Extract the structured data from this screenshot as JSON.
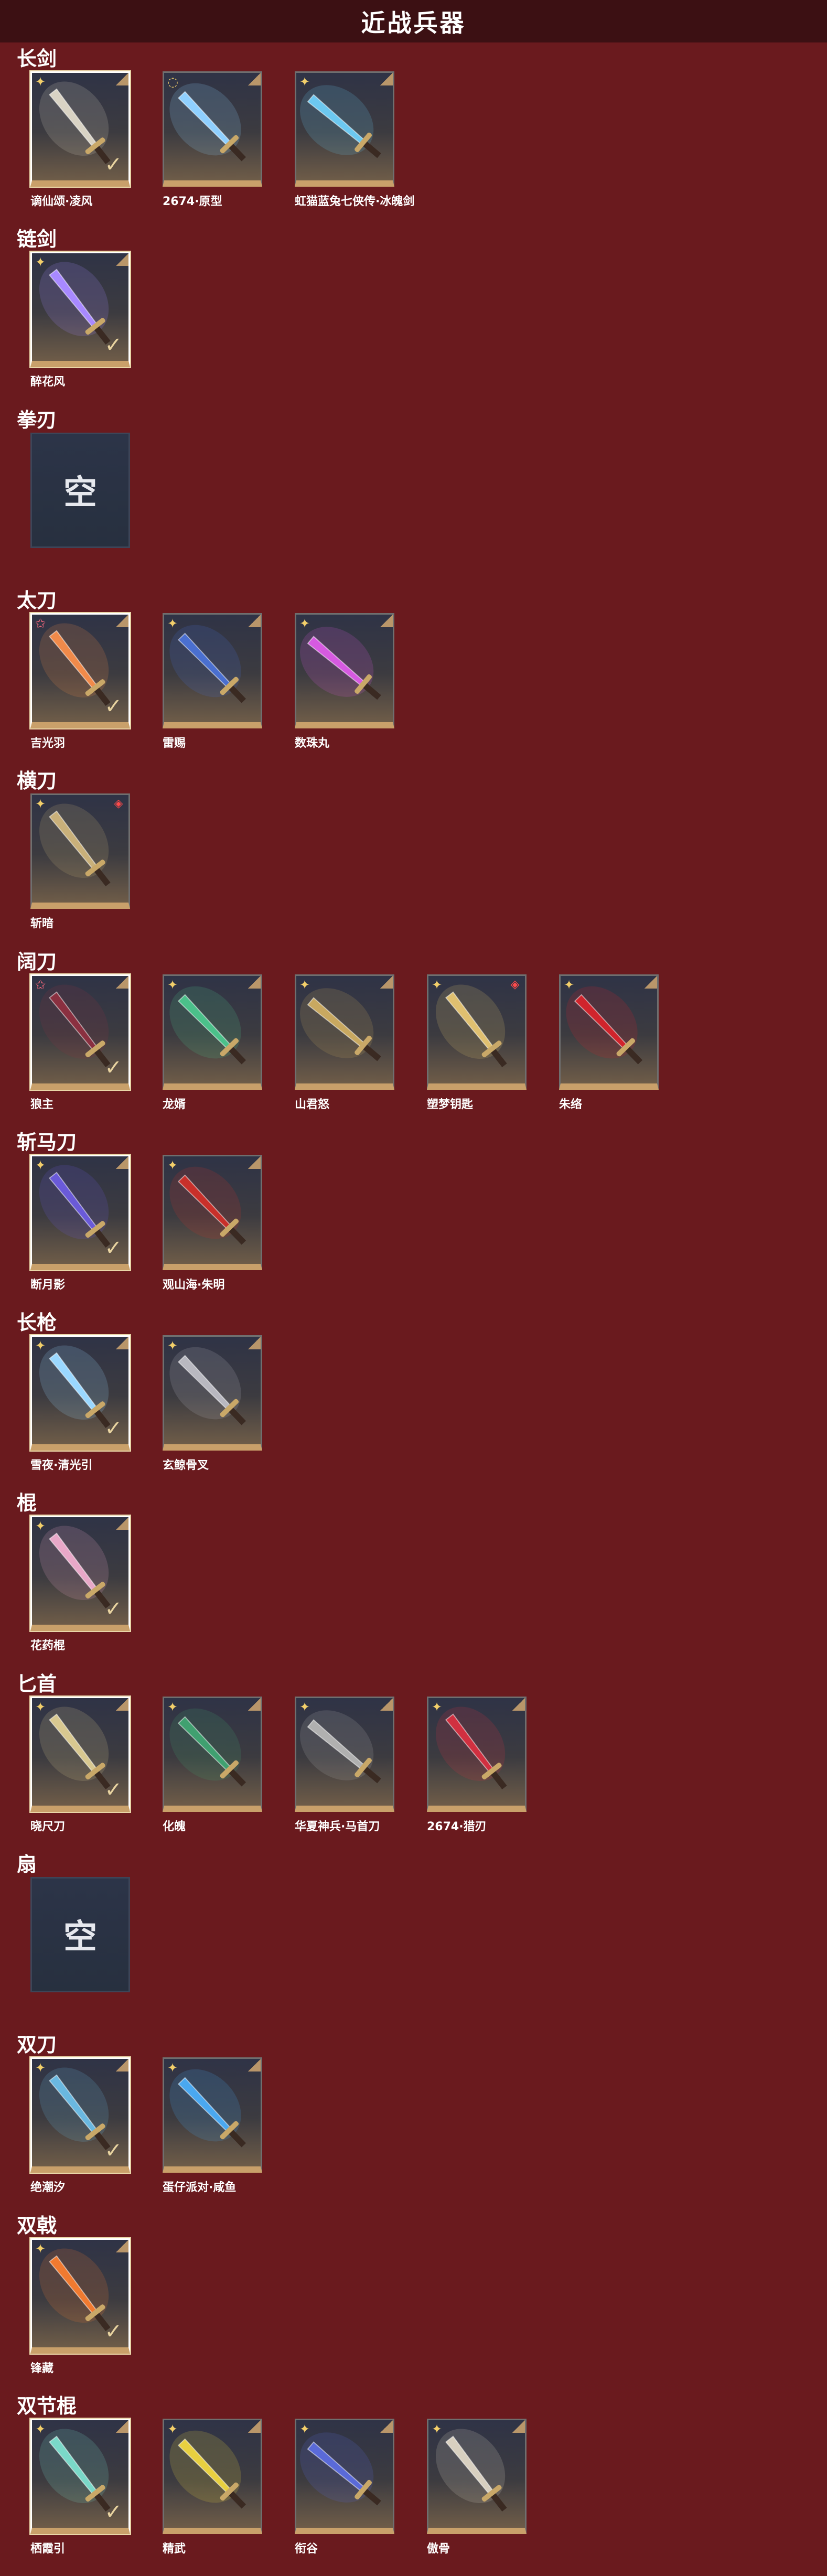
{
  "page": {
    "title": "近战兵器"
  },
  "categories": [
    {
      "title": "长剑",
      "items": [
        {
          "name": "谪仙颂·凌风",
          "rarity": "gold",
          "selected": true,
          "art": "sword-dark-icon",
          "color": "#d9d3c4"
        },
        {
          "name": "2674·原型",
          "rarity": "rainbow",
          "selected": false,
          "art": "sword-light-icon",
          "color": "#8fd0ff"
        },
        {
          "name": "虹猫蓝兔七侠传·冰魄剑",
          "rarity": "gold",
          "selected": false,
          "art": "sword-ice-icon",
          "color": "#6cc8f0"
        }
      ]
    },
    {
      "title": "链剑",
      "items": [
        {
          "name": "醉花风",
          "rarity": "gold",
          "selected": true,
          "art": "chain-sword-icon",
          "color": "#a889ff"
        }
      ]
    },
    {
      "title": "拳刃",
      "items": [
        {
          "name": "",
          "empty": true,
          "empty_text": "空"
        }
      ]
    },
    {
      "title": "太刀",
      "items": [
        {
          "name": "吉光羽",
          "rarity": "pink",
          "selected": true,
          "art": "katana-flame-icon",
          "color": "#f08a4a"
        },
        {
          "name": "雷赐",
          "rarity": "gold",
          "selected": false,
          "art": "katana-blue-icon",
          "color": "#4a6fd0"
        },
        {
          "name": "数珠丸",
          "rarity": "gold",
          "selected": false,
          "art": "katana-purple-icon",
          "color": "#d65ae0"
        }
      ]
    },
    {
      "title": "横刀",
      "items": [
        {
          "name": "斩暗",
          "rarity": "gold",
          "selected": false,
          "art": "saber-gold-icon",
          "color": "#c9b07a",
          "badge": "red-diamond"
        }
      ]
    },
    {
      "title": "阔刀",
      "items": [
        {
          "name": "狼主",
          "rarity": "pink",
          "selected": true,
          "art": "broadblade-dark-icon",
          "color": "#8a3040"
        },
        {
          "name": "龙婿",
          "rarity": "gold",
          "selected": false,
          "art": "broadblade-jade-icon",
          "color": "#4bc08a"
        },
        {
          "name": "山君怒",
          "rarity": "gold",
          "selected": false,
          "art": "broadblade-gold-icon",
          "color": "#c8a860"
        },
        {
          "name": "塑梦钥匙",
          "rarity": "gold",
          "selected": false,
          "art": "broadblade-key-icon",
          "color": "#e0c070",
          "badge": "red-diamond"
        },
        {
          "name": "朱络",
          "rarity": "gold",
          "selected": false,
          "art": "broadblade-red-icon",
          "color": "#d0242c"
        }
      ]
    },
    {
      "title": "斩马刀",
      "items": [
        {
          "name": "断月影",
          "rarity": "gold",
          "selected": true,
          "art": "glaive-purple-icon",
          "color": "#6a5ad8"
        },
        {
          "name": "观山海·朱明",
          "rarity": "gold",
          "selected": false,
          "art": "glaive-red-icon",
          "color": "#c8302a"
        }
      ]
    },
    {
      "title": "长枪",
      "items": [
        {
          "name": "雪夜·清光引",
          "rarity": "gold",
          "selected": true,
          "art": "spear-ice-icon",
          "color": "#9ad8ff"
        },
        {
          "name": "玄鲸骨叉",
          "rarity": "gold",
          "selected": false,
          "art": "trident-silver-icon",
          "color": "#b8b8c0"
        }
      ]
    },
    {
      "title": "棍",
      "items": [
        {
          "name": "花药棍",
          "rarity": "gold",
          "selected": true,
          "art": "staff-flower-icon",
          "color": "#e8a8c8"
        }
      ]
    },
    {
      "title": "匕首",
      "items": [
        {
          "name": "晓尺刀",
          "rarity": "gold",
          "selected": true,
          "art": "dagger-gold-icon",
          "color": "#d8c890"
        },
        {
          "name": "化魄",
          "rarity": "gold",
          "selected": false,
          "art": "dagger-green-icon",
          "color": "#40a070"
        },
        {
          "name": "华夏神兵·马首刀",
          "rarity": "gold",
          "selected": false,
          "art": "dagger-horse-icon",
          "color": "#b0b0b0"
        },
        {
          "name": "2674·猎刃",
          "rarity": "gold",
          "selected": false,
          "art": "dagger-red-icon",
          "color": "#d03040"
        }
      ]
    },
    {
      "title": "扇",
      "items": [
        {
          "name": "",
          "empty": true,
          "empty_text": "空"
        }
      ]
    },
    {
      "title": "双刀",
      "items": [
        {
          "name": "绝潮汐",
          "rarity": "gold",
          "selected": true,
          "art": "twin-blades-tide-icon",
          "color": "#6ab8e0"
        },
        {
          "name": "蛋仔派对·咸鱼",
          "rarity": "gold",
          "selected": false,
          "art": "twin-blades-fish-icon",
          "color": "#4aa8f0"
        }
      ]
    },
    {
      "title": "双戟",
      "items": [
        {
          "name": "锋藏",
          "rarity": "gold",
          "selected": true,
          "art": "twin-halberd-flame-icon",
          "color": "#f07a30"
        }
      ]
    },
    {
      "title": "双节棍",
      "items": [
        {
          "name": "栖霞引",
          "rarity": "gold",
          "selected": true,
          "art": "nunchaku-jade-icon",
          "color": "#7ad8c8"
        },
        {
          "name": "精武",
          "rarity": "gold",
          "selected": false,
          "art": "nunchaku-yellow-icon",
          "color": "#e8d040"
        },
        {
          "name": "衔谷",
          "rarity": "gold",
          "selected": false,
          "art": "nunchaku-blue-icon",
          "color": "#5a6ad8"
        },
        {
          "name": "傲骨",
          "rarity": "gold",
          "selected": false,
          "art": "nunchaku-bone-icon",
          "color": "#d8d0c0"
        }
      ]
    }
  ]
}
